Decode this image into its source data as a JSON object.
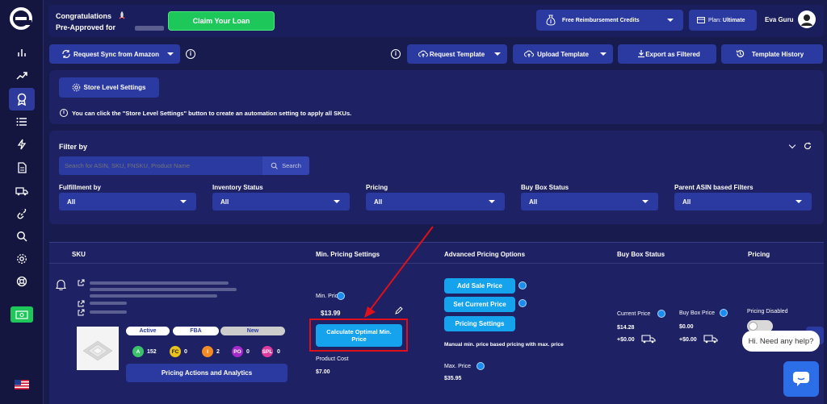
{
  "header": {
    "congrats_line1": "Congratulations",
    "congrats_line2": "Pre-Approved for",
    "claim_label": "Claim Your Loan",
    "reimbursement_label": "Free Reimbursement Credits",
    "plan_prefix": "Plan:",
    "plan_value": "Ultimate",
    "user_name": "Eva Guru"
  },
  "toolbar": {
    "sync_label": "Request Sync from Amazon",
    "request_template_label": "Request Template",
    "upload_template_label": "Upload Template",
    "export_label": "Export as Filtered",
    "history_label": "Template History"
  },
  "store": {
    "button_label": "Store Level Settings",
    "info_text": "You can click the \"Store Level Settings\" button to create an automation setting to apply all SKUs."
  },
  "filter": {
    "title": "Filter by",
    "search_placeholder": "Search for ASIN, SKU, FNSKU, Product Name",
    "search_button": "Search",
    "fields": [
      {
        "label": "Fulfillment by",
        "value": "All"
      },
      {
        "label": "Inventory Status",
        "value": "All"
      },
      {
        "label": "Pricing",
        "value": "All"
      },
      {
        "label": "Buy Box Status",
        "value": "All"
      },
      {
        "label": "Parent ASIN based Filters",
        "value": "All"
      }
    ]
  },
  "table": {
    "headers": [
      "SKU",
      "Min. Pricing Settings",
      "Advanced Pricing Options",
      "Buy Box Status",
      "Pricing"
    ]
  },
  "row": {
    "tags": [
      "Active",
      "FBA",
      "New"
    ],
    "counters": [
      {
        "code": "A",
        "value": "152",
        "color": "#3cc26b"
      },
      {
        "code": "FC",
        "value": "0",
        "color": "#e8c21f"
      },
      {
        "code": "I",
        "value": "2",
        "color": "#f28b25"
      },
      {
        "code": "PO",
        "value": "0",
        "color": "#a52ac9"
      },
      {
        "code": "SPL",
        "value": "0",
        "color": "#e03aa0"
      }
    ],
    "actions_label": "Pricing Actions and Analytics",
    "min_price_label": "Min. Price",
    "min_price_value": "$13.99",
    "calculate_label": "Calculate Optimal Min. Price",
    "product_cost_label": "Product Cost",
    "product_cost_value": "$7.00",
    "add_sale_label": "Add Sale Price",
    "set_current_label": "Set Current Price",
    "pricing_settings_label": "Pricing Settings",
    "manual_note": "Manual min. price based pricing with max. price",
    "max_price_label": "Max. Price",
    "max_price_value": "$35.95",
    "current_price_label": "Current Price",
    "current_price_value": "$14.28",
    "current_price_extra": "+$0.00",
    "buybox_price_label": "Buy Box Price",
    "buybox_price_value": "$0.00",
    "buybox_price_extra": "+$0.00",
    "pricing_status": "Pricing Disabled"
  },
  "chat": {
    "bubble": "Hi. Need any help?"
  },
  "colors": {
    "accent": "#2b3aa0",
    "cyan_button": "#16a3ee",
    "claim_green": "#1ec75a",
    "highlight_red": "#e0101a"
  }
}
